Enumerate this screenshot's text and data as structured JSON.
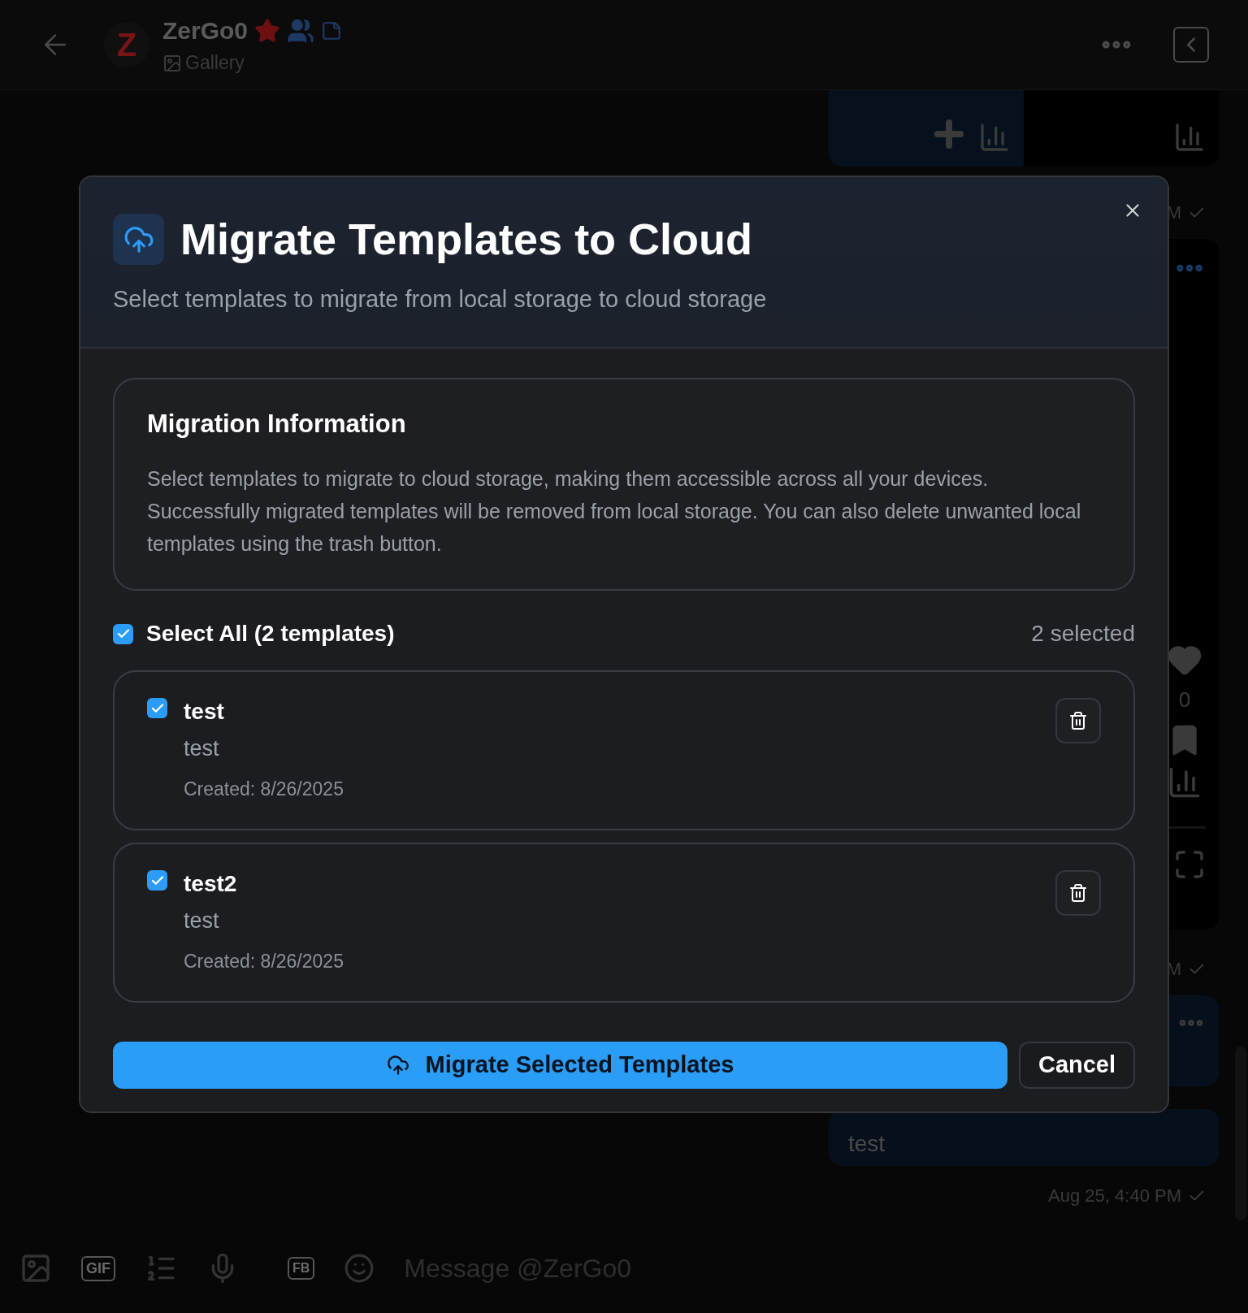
{
  "header": {
    "avatar_letter": "Z",
    "name": "ZerGo0",
    "subtitle": "Gallery"
  },
  "feed": {
    "timestamps": [
      "M",
      "M"
    ],
    "like_count": "0",
    "message": "test",
    "last_time": "Aug 25, 4:40 PM"
  },
  "composer": {
    "gif_label": "GIF",
    "fb_label": "FB",
    "placeholder": "Message @ZerGo0"
  },
  "dialog": {
    "title": "Migrate Templates to Cloud",
    "subtitle": "Select templates to migrate from local storage to cloud storage",
    "info": {
      "heading": "Migration Information",
      "body": "Select templates to migrate to cloud storage, making them accessible across all your devices. Successfully migrated templates will be removed from local storage. You can also delete unwanted local templates using the trash button."
    },
    "select_all": {
      "label": "Select All (2 templates)",
      "checked": true
    },
    "count": "2 selected",
    "templates": [
      {
        "name": "test",
        "description": "test",
        "created": "Created: 8/26/2025",
        "selected": true
      },
      {
        "name": "test2",
        "description": "test",
        "created": "Created: 8/26/2025",
        "selected": true
      }
    ],
    "primary_button": "Migrate Selected Templates",
    "cancel_button": "Cancel"
  }
}
